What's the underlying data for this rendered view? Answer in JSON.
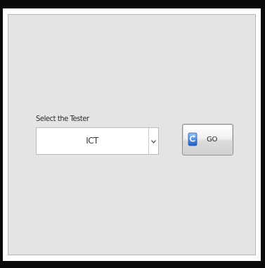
{
  "form": {
    "tester_label": "Select the Tester",
    "tester_select": {
      "selected_value": "ICT"
    },
    "go_button": {
      "label": "GO",
      "icon": "refresh-icon"
    }
  },
  "colors": {
    "background": "#e4e4e4",
    "frame": "#0a0a0a",
    "icon_blue": "#3a7fd8"
  }
}
